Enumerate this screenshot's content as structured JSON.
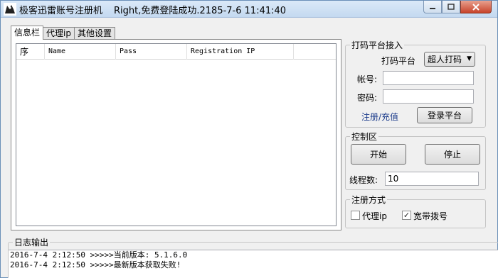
{
  "window": {
    "title": "极客迅雷账号注册机",
    "status": "Right,免费登陆成功.2185-7-6 11:41:40",
    "icon": "app-logo-icon"
  },
  "tabs": [
    "信息栏",
    "代理ip",
    "其他设置"
  ],
  "list": {
    "columns": [
      "序",
      "Name",
      "Pass",
      "Registration IP"
    ],
    "rows": []
  },
  "captcha": {
    "title": "打码平台接入",
    "platform_label": "打码平台",
    "platform_value": "超人打码",
    "account_label": "帐号:",
    "account_value": "",
    "password_label": "密码:",
    "password_value": "",
    "register_link": "注册/充值",
    "login_button": "登录平台"
  },
  "control": {
    "title": "控制区",
    "start_button": "开始",
    "stop_button": "停止",
    "threads_label": "线程数:",
    "threads_value": "10"
  },
  "register_mode": {
    "title": "注册方式",
    "proxy_label": "代理ip",
    "proxy_checked": false,
    "broadband_label": "宽带拨号",
    "broadband_checked": true
  },
  "log": {
    "title": "日志输出",
    "lines": [
      "2016-7-4 2:12:50 >>>>>当前版本: 5.1.6.0",
      "2016-7-4 2:12:50 >>>>>最新版本获取失败!"
    ]
  }
}
